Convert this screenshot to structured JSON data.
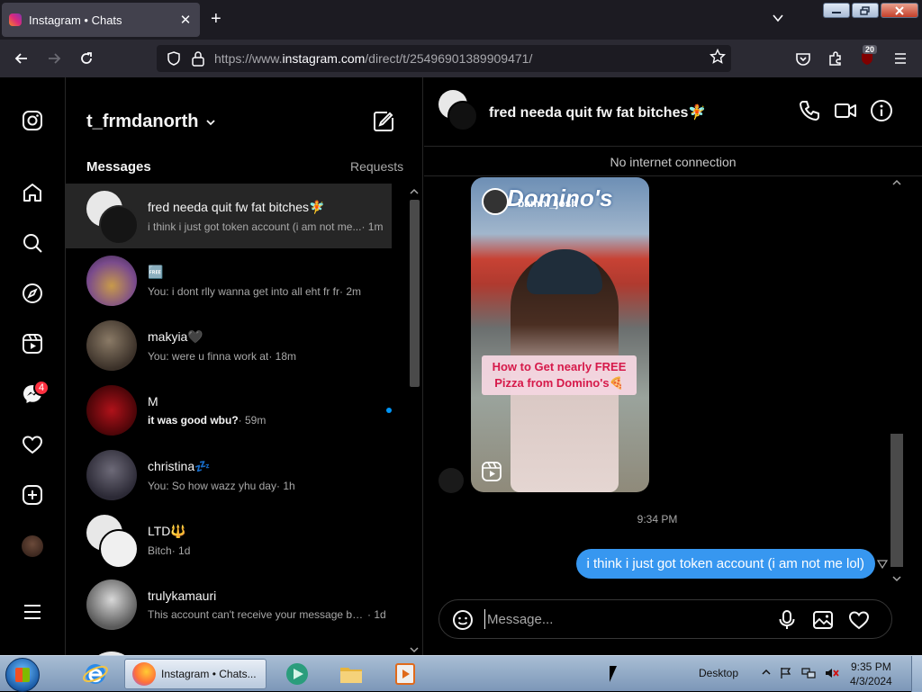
{
  "browser": {
    "tab_title": "Instagram • Chats",
    "tab_close": "✕",
    "new_tab": "+",
    "url_prefix": "https://www.",
    "url_domain": "instagram.com",
    "url_path": "/direct/t/25496901389909471/",
    "extension_badge": "20"
  },
  "rail": {
    "notification_count": "4"
  },
  "inbox": {
    "username": "t_frmdanorth",
    "messages_label": "Messages",
    "requests_label": "Requests",
    "conversations": [
      {
        "name": "fred needa quit fw fat bitches🧚",
        "preview": "i think i just got token account (i am not me...",
        "time": " · 1m",
        "bold": false,
        "active": true
      },
      {
        "name": "🆓",
        "preview": "You: i dont rlly wanna get into all eht fr fr",
        "time": " · 2m",
        "bold": false,
        "active": false
      },
      {
        "name": "makyia🖤",
        "preview": "You: were u finna work at",
        "time": " · 18m",
        "bold": false,
        "active": false
      },
      {
        "name": "M",
        "preview": "it was good wbu?",
        "time": " · 59m",
        "bold": true,
        "active": false
      },
      {
        "name": "christina💤",
        "preview": "You: So how wazz yhu day",
        "time": " · 1h",
        "bold": false,
        "active": false
      },
      {
        "name": "LTD🔱",
        "preview": "Bitch",
        "time": " · 1d",
        "bold": false,
        "active": false
      },
      {
        "name": "trulykamauri",
        "preview": "This account can't receive your message bec...",
        "time": " · 1d",
        "bold": false,
        "active": false
      }
    ]
  },
  "chat": {
    "title": "fred needa quit fw fat bitches🧚",
    "offline_notice": "No internet connection",
    "reel": {
      "handle": "bamn._josh",
      "sign_text": "Domino's",
      "caption_line1": "How to Get nearly FREE",
      "caption_line2": "Pizza from Domino's🍕"
    },
    "timestamp": "9:34 PM",
    "sent_message": "i think i just got token account (i am not me lol)",
    "composer_placeholder": "Message..."
  },
  "taskbar": {
    "firefox_label": "Instagram • Chats...",
    "desktop_label": "Desktop",
    "time": "9:35 PM",
    "date": "4/3/2024"
  },
  "colors": {
    "accent_blue": "#3797f0",
    "unread_dot": "#0095f6",
    "badge_red": "#ff3040"
  }
}
